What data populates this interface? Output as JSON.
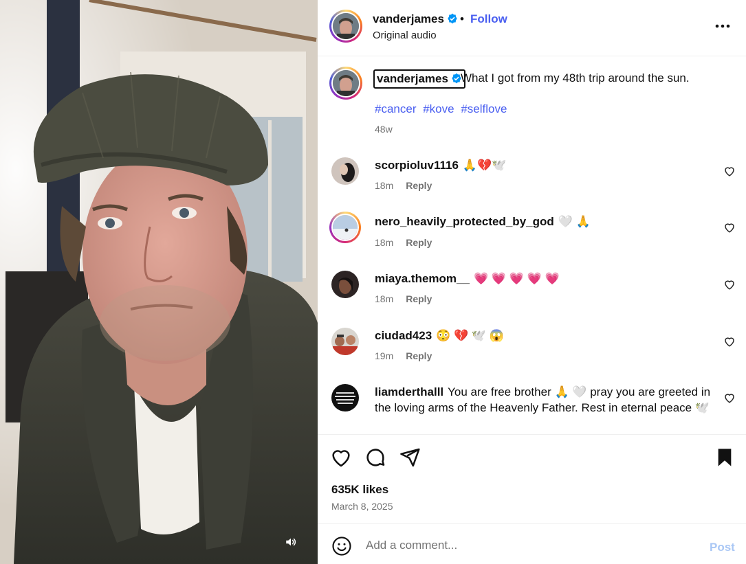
{
  "post": {
    "author": "vanderjames",
    "audio": "Original audio",
    "follow_label": "Follow",
    "dot": "•",
    "caption": "What I got from my 48th trip around the sun.",
    "hashtags": [
      "#cancer",
      "#kove",
      "#selflove"
    ],
    "age": "48w",
    "likes": "635K likes",
    "date": "March 8, 2025"
  },
  "comments": [
    {
      "user": "scorpioluv1116",
      "text": "🙏💔🕊️",
      "age": "18m",
      "reply": "Reply"
    },
    {
      "user": "nero_heavily_protected_by_god",
      "text": "🤍 🙏",
      "age": "18m",
      "reply": "Reply"
    },
    {
      "user": "miaya.themom__",
      "text": "💗 💗 💗 💗 💗",
      "age": "18m",
      "reply": "Reply"
    },
    {
      "user": "ciudad423",
      "text": "😳 💔 🕊️ 😱",
      "age": "19m",
      "reply": "Reply"
    },
    {
      "user": "liamderthalll",
      "text": "You are free brother 🙏 🤍  pray you are greeted in the loving arms of the Heavenly Father. Rest in eternal peace 🕊️",
      "age": "",
      "reply": ""
    }
  ],
  "composer": {
    "placeholder": "Add a comment...",
    "post_label": "Post"
  },
  "icons": {
    "more": "more-options-icon",
    "like": "heart-icon",
    "comment": "comment-icon",
    "share": "share-icon",
    "save": "bookmark-icon",
    "emoji": "emoji-icon",
    "volume": "volume-icon"
  },
  "colors": {
    "link": "#4a5ff0",
    "verified": "#0095f6",
    "post_disabled": "#a9c7f5"
  }
}
